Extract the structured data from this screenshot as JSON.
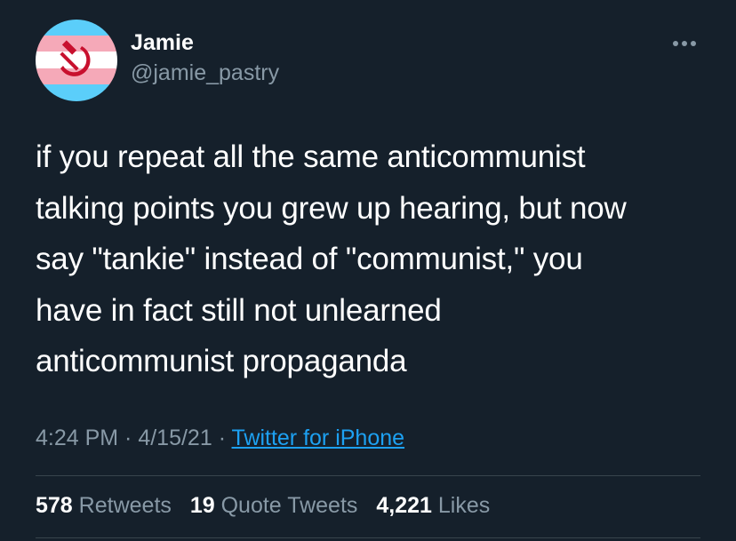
{
  "user": {
    "display_name": "Jamie",
    "handle": "@jamie_pastry",
    "avatar_icon": "trans-flag-hammer-sickle-avatar"
  },
  "more_icon": "more-horizontal-icon",
  "tweet": {
    "lines": [
      "if you repeat all the same anticommunist",
      "talking points you grew up hearing, but now",
      "say \"tankie\" instead of \"communist,\" you",
      "have in fact still not unlearned",
      "anticommunist propaganda"
    ]
  },
  "meta": {
    "time": "4:24 PM",
    "sep1": " · ",
    "date": "4/15/21",
    "sep2": " · ",
    "source": "Twitter for iPhone"
  },
  "stats": {
    "retweets_count": "578",
    "retweets_label": "Retweets",
    "quotes_count": "19",
    "quotes_label": "Quote Tweets",
    "likes_count": "4,221",
    "likes_label": "Likes"
  },
  "colors": {
    "background": "#15202b",
    "secondary_text": "#8899a6",
    "link": "#1da1f2",
    "divider": "#38444d",
    "flag_blue": "#5bcefa",
    "flag_pink": "#f5a9b8",
    "flag_white": "#ffffff",
    "emblem_red": "#c8102e"
  }
}
